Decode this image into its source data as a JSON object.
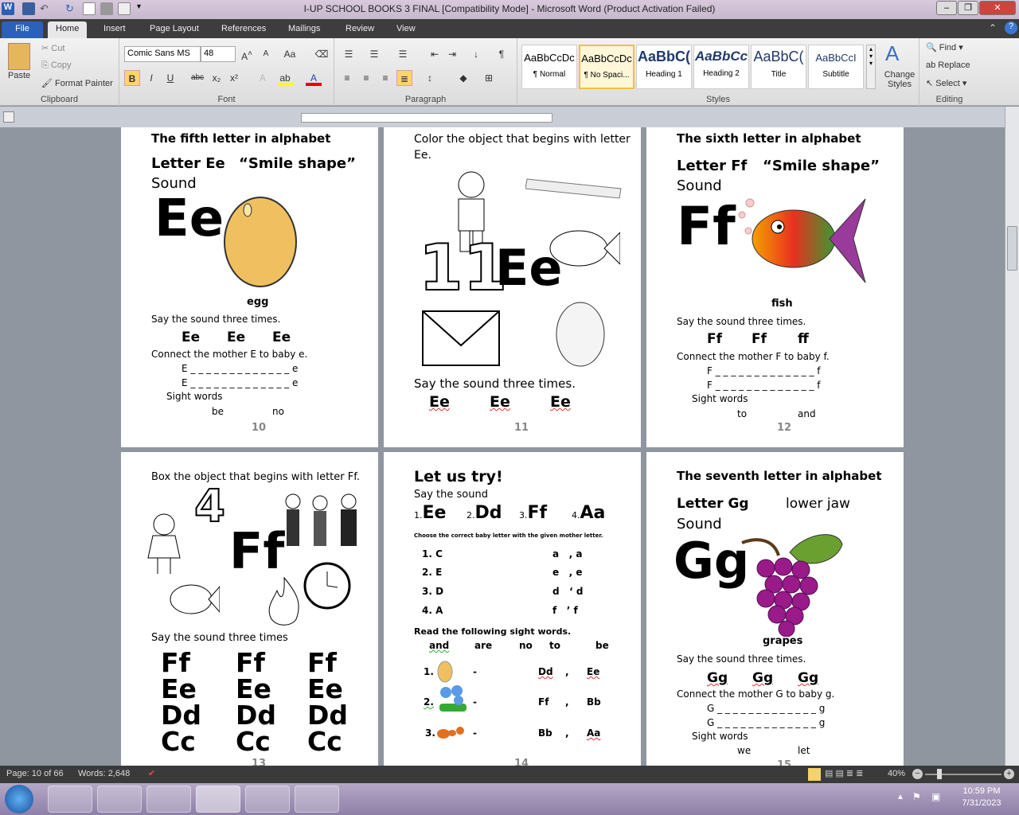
{
  "window": {
    "title": "I-UP SCHOOL BOOKS 3 FINAL [Compatibility Mode] - Microsoft Word (Product Activation Failed)"
  },
  "tabs": [
    "File",
    "Home",
    "Insert",
    "Page Layout",
    "References",
    "Mailings",
    "Review",
    "View"
  ],
  "clipboard": {
    "paste": "Paste",
    "cut": "Cut",
    "copy": "Copy",
    "format_painter": "Format Painter",
    "label": "Clipboard"
  },
  "font": {
    "name": "Comic Sans MS",
    "size": "48",
    "label": "Font"
  },
  "paragraph": {
    "label": "Paragraph"
  },
  "styles": {
    "items": [
      {
        "preview": "AaBbCcDc",
        "name": "¶ Normal"
      },
      {
        "preview": "AaBbCcDc",
        "name": "¶ No Spaci..."
      },
      {
        "preview": "AaBbC(",
        "name": "Heading 1"
      },
      {
        "preview": "AaBbCc",
        "name": "Heading 2"
      },
      {
        "preview": "AaBbC(",
        "name": "Title"
      },
      {
        "preview": "AaBbCcI",
        "name": "Subtitle"
      }
    ],
    "change": "Change Styles",
    "label": "Styles"
  },
  "editing": {
    "find": "Find",
    "replace": "Replace",
    "select": "Select",
    "label": "Editing"
  },
  "p10": {
    "h1": "The fifth letter in alphabet",
    "h2a": "Letter Ee",
    "h2b": "“Smile shape”",
    "sound": "Sound",
    "big": "Ee",
    "word": "egg",
    "say": "Say the sound three times.",
    "rep": [
      "Ee",
      "Ee",
      "Ee"
    ],
    "connect": "Connect the mother E to baby e.",
    "line1": "E _ _ _ _ _ _ _ _ _ _ _ _ _ e",
    "line2": "E _ _ _ _ _ _ _ _ _ _ _ _ _ e",
    "sight": "Sight words",
    "w1": "be",
    "w2": "no",
    "num": "10"
  },
  "p11": {
    "h1": "Color the object that begins with letter Ee.",
    "num_big": "11",
    "big": "Ee",
    "say": "Say the sound three times.",
    "rep": [
      "Ee",
      "Ee",
      "Ee"
    ],
    "num": "11"
  },
  "p12": {
    "h1": "The sixth letter in alphabet",
    "h2a": "Letter Ff",
    "h2b": "“Smile shape”",
    "sound": "Sound",
    "big": "Ff",
    "word": "fish",
    "say": "Say the sound three times.",
    "rep": [
      "Ff",
      "Ff",
      "ff"
    ],
    "connect": "Connect the mother F to baby f.",
    "line1": "F _ _ _ _ _ _ _ _ _ _ _ _ _ f",
    "line2": "F _ _ _ _ _ _ _ _ _ _ _ _ _ f",
    "sight": "Sight words",
    "w1": "to",
    "w2": "and",
    "num": "12"
  },
  "p13": {
    "h1": "Box the object that begins with letter Ff.",
    "num_big": "4",
    "big": "Ff",
    "say": "Say the sound three times",
    "cols": [
      [
        "Ff",
        "Ee",
        "Dd",
        "Cc"
      ],
      [
        "Ff",
        "Ee",
        "Dd",
        "Cc"
      ],
      [
        "Ff",
        "Ee",
        "Dd",
        "Cc"
      ]
    ],
    "num": "13"
  },
  "p14": {
    "h1": "Let us try!",
    "sub": "Say the sound",
    "letters": [
      {
        "n": "1.",
        "l": "Ee"
      },
      {
        "n": "2.",
        "l": "Dd"
      },
      {
        "n": "3.",
        "l": "Ff"
      },
      {
        "n": "4.",
        "l": "Aa"
      }
    ],
    "choose": "Choose the correct baby letter with the given mother letter.",
    "rows": [
      {
        "q": "1. C",
        "a": "a   , a"
      },
      {
        "q": "2. E",
        "a": "e   , e"
      },
      {
        "q": "3. D",
        "a": "d   ‘ d"
      },
      {
        "q": "4. A",
        "a": "f   ’ f"
      }
    ],
    "read": "Read the following sight words.",
    "words": [
      "and",
      "are",
      "no",
      "to",
      "be"
    ],
    "pics": [
      {
        "n": "1.",
        "a": "Dd",
        "b": "Ee"
      },
      {
        "n": "2.",
        "a": "Ff",
        "b": "Bb"
      },
      {
        "n": "3.",
        "a": "Bb",
        "b": "Aa"
      }
    ],
    "dash": "-",
    "comma": ",",
    "num": "14"
  },
  "p15": {
    "h1": "The seventh letter in alphabet",
    "h2a": "Letter Gg",
    "h2b": "lower jaw",
    "sound": "Sound",
    "big": "Gg",
    "word": "grapes",
    "say": "Say the sound three times.",
    "rep": [
      "Gg",
      "Gg",
      "Gg"
    ],
    "connect": "Connect the mother G to baby g.",
    "line1": "G _ _ _ _ _ _ _ _ _ _ _ _ _ g",
    "line2": "G _ _ _ _ _ _ _ _ _ _ _ _ _ g",
    "sight": "Sight words",
    "w1": "we",
    "w2": "let",
    "num": "15"
  },
  "status": {
    "page": "Page: 10 of 66",
    "words": "Words: 2,648",
    "zoom": "40%"
  },
  "clock": {
    "time": "10:59 PM",
    "date": "7/31/2023"
  }
}
